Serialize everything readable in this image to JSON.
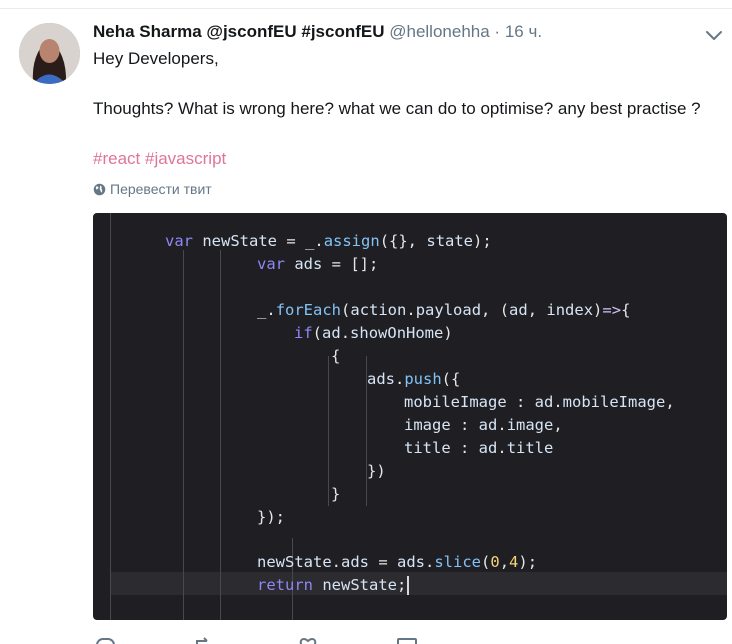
{
  "tweet": {
    "author_name": "Neha Sharma @jsconfEU #jsconfEU",
    "author_handle": "@hellonehha",
    "time_sep": "·",
    "time": "16 ч.",
    "greeting": "Hey Developers,",
    "body": "Thoughts? What is wrong here? what we can do to optimise? any best practise ?",
    "hashtags": [
      "#react",
      "#javascript"
    ],
    "translate_label": "Перевести твит"
  },
  "code": {
    "lines": [
      [
        [
          "kw",
          "var"
        ],
        [
          "pu",
          " "
        ],
        [
          "id",
          "newState"
        ],
        [
          "pu",
          " = "
        ],
        [
          "id",
          "_"
        ],
        [
          "pu",
          "."
        ],
        [
          "fn",
          "assign"
        ],
        [
          "pu",
          "({}, "
        ],
        [
          "id",
          "state"
        ],
        [
          "pu",
          ");"
        ]
      ],
      [
        [
          "kw",
          "var"
        ],
        [
          "pu",
          " "
        ],
        [
          "id",
          "ads"
        ],
        [
          "pu",
          " = [];"
        ]
      ],
      [],
      [
        [
          "id",
          "_"
        ],
        [
          "pu",
          "."
        ],
        [
          "fn",
          "forEach"
        ],
        [
          "pu",
          "("
        ],
        [
          "id",
          "action"
        ],
        [
          "pu",
          "."
        ],
        [
          "id",
          "payload"
        ],
        [
          "pu",
          ", ("
        ],
        [
          "id",
          "ad"
        ],
        [
          "pu",
          ", "
        ],
        [
          "id",
          "index"
        ],
        [
          "pu",
          ")"
        ],
        [
          "arrow",
          "=>"
        ],
        [
          "pu",
          "{"
        ]
      ],
      [
        [
          "kw",
          "if"
        ],
        [
          "pu",
          "("
        ],
        [
          "id",
          "ad"
        ],
        [
          "pu",
          "."
        ],
        [
          "id",
          "showOnHome"
        ],
        [
          "pu",
          ")"
        ]
      ],
      [
        [
          "pu",
          "{"
        ]
      ],
      [
        [
          "id",
          "ads"
        ],
        [
          "pu",
          "."
        ],
        [
          "fn",
          "push"
        ],
        [
          "pu",
          "({"
        ]
      ],
      [
        [
          "id",
          "mobileImage"
        ],
        [
          "pu",
          " : "
        ],
        [
          "id",
          "ad"
        ],
        [
          "pu",
          "."
        ],
        [
          "id",
          "mobileImage"
        ],
        [
          "pu",
          ","
        ]
      ],
      [
        [
          "id",
          "image"
        ],
        [
          "pu",
          " : "
        ],
        [
          "id",
          "ad"
        ],
        [
          "pu",
          "."
        ],
        [
          "id",
          "image"
        ],
        [
          "pu",
          ","
        ]
      ],
      [
        [
          "id",
          "title"
        ],
        [
          "pu",
          " : "
        ],
        [
          "id",
          "ad"
        ],
        [
          "pu",
          "."
        ],
        [
          "id",
          "title"
        ]
      ],
      [
        [
          "pu",
          "})"
        ]
      ],
      [
        [
          "pu",
          "}"
        ]
      ],
      [
        [
          "pu",
          "});"
        ]
      ],
      [],
      [
        [
          "id",
          "newState"
        ],
        [
          "pu",
          "."
        ],
        [
          "id",
          "ads"
        ],
        [
          "pu",
          " = "
        ],
        [
          "id",
          "ads"
        ],
        [
          "pu",
          "."
        ],
        [
          "fn",
          "slice"
        ],
        [
          "pu",
          "("
        ],
        [
          "num",
          "0"
        ],
        [
          "pu",
          ","
        ],
        [
          "num",
          "4"
        ],
        [
          "pu",
          ");"
        ]
      ],
      [
        [
          "kw",
          "return"
        ],
        [
          "pu",
          " "
        ],
        [
          "id",
          "newState"
        ],
        [
          "pu",
          ";"
        ]
      ]
    ]
  },
  "colors": {
    "hashtag": "#e0749a",
    "muted": "#657786",
    "code_bg": "#1f1f23",
    "keyword": "#8f87f5",
    "function": "#83c2f5",
    "identifier": "#d6e4f5",
    "number": "#f5d37a"
  },
  "icons": [
    "avatar",
    "chevron-down-icon",
    "globe-icon",
    "reply-icon",
    "retweet-icon",
    "like-icon",
    "message-icon"
  ]
}
